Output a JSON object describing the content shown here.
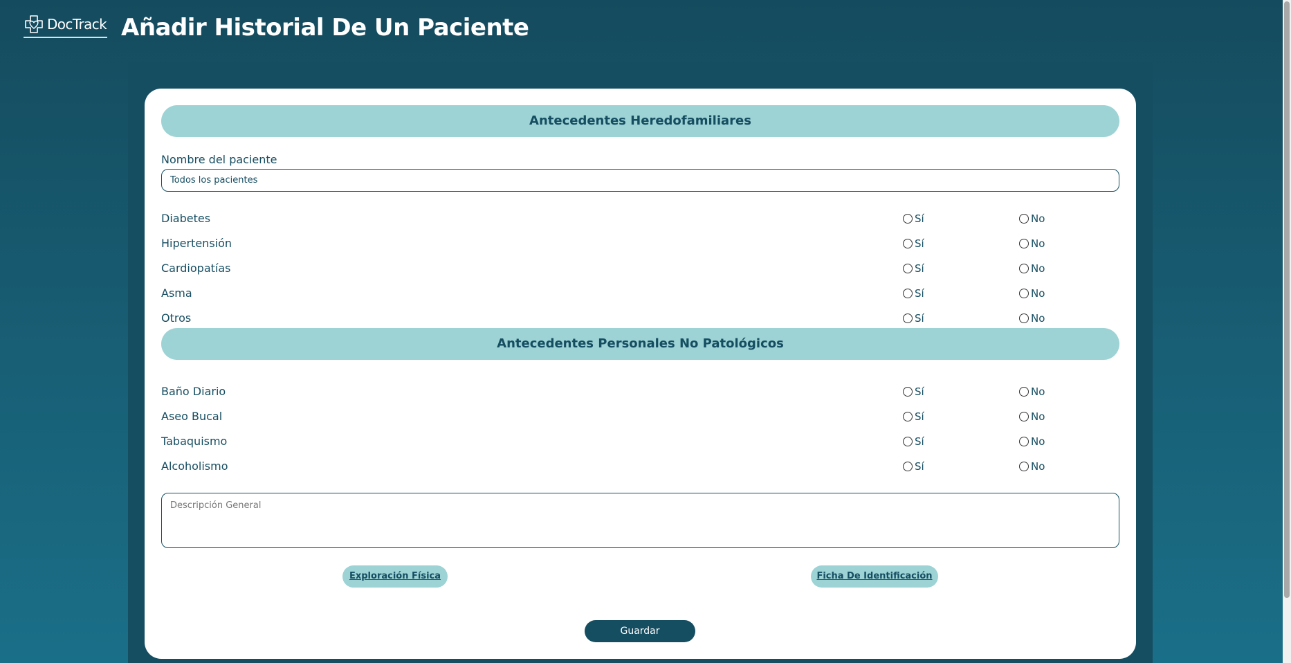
{
  "header": {
    "logo_text": "DocTrack",
    "title": "Añadir Historial De Un Paciente"
  },
  "section1": {
    "title": "Antecedentes Heredofamiliares",
    "patient_label": "Nombre del paciente",
    "patient_value": "Todos los pacientes",
    "rows": [
      {
        "label": "Diabetes"
      },
      {
        "label": "Hipertensión"
      },
      {
        "label": "Cardiopatías"
      },
      {
        "label": "Asma"
      },
      {
        "label": "Otros"
      }
    ]
  },
  "section2": {
    "title": "Antecedentes Personales No Patológicos",
    "rows": [
      {
        "label": "Baño Diario"
      },
      {
        "label": "Aseo Bucal"
      },
      {
        "label": "Tabaquismo"
      },
      {
        "label": "Alcoholismo"
      }
    ]
  },
  "options": {
    "yes": "Sí",
    "no": "No"
  },
  "description": {
    "placeholder": "Descripción General"
  },
  "links": {
    "physical_exam": "Exploración Física",
    "id_card": "Ficha De Identificación"
  },
  "save_label": "Guardar",
  "colors": {
    "primary": "#154d61",
    "accent": "#9dd3d5",
    "background": "#1a6f88"
  }
}
